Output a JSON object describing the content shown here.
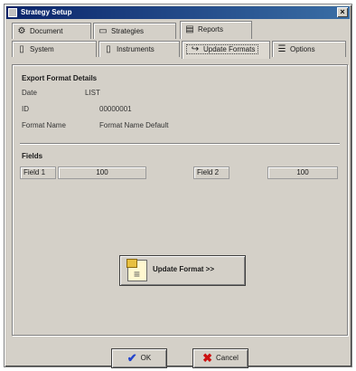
{
  "window": {
    "title": "Strategy Setup"
  },
  "tabs_row1": [
    {
      "label": "Document",
      "icon": "document-icon"
    },
    {
      "label": "Strategies",
      "icon": "strategies-icon"
    },
    {
      "label": "Reports",
      "icon": "reports-icon"
    }
  ],
  "tabs_row2": [
    {
      "label": "System",
      "icon": "system-icon"
    },
    {
      "label": "Instruments",
      "icon": "instruments-icon"
    },
    {
      "label": "Update Formats",
      "icon": "update-formats-icon"
    },
    {
      "label": "Options",
      "icon": "options-icon"
    }
  ],
  "section_details": {
    "title": "Export Format Details",
    "rows": [
      {
        "label": "Date",
        "value": "LIST"
      },
      {
        "label": "ID",
        "value": "00000001"
      },
      {
        "label": "Format Name",
        "value": "Format Name Default"
      }
    ]
  },
  "section_fields": {
    "title": "Fields",
    "field1_label": "Field 1",
    "field1_value": "100",
    "field2_label": "Field 2",
    "field2_value": "100"
  },
  "update_button": {
    "label": "Update Format >>"
  },
  "buttons": {
    "ok": "OK",
    "cancel": "Cancel"
  },
  "colors": {
    "ok_check": "#2244cc",
    "cancel_x": "#cc1111",
    "titlebar": "#0a246a"
  }
}
